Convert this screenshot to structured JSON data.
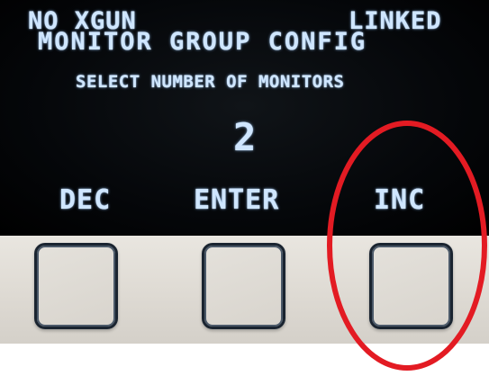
{
  "status": {
    "xgun": "NO XGUN",
    "link": "LINKED"
  },
  "screen": {
    "title": "MONITOR GROUP CONFIG",
    "prompt": "SELECT NUMBER OF MONITORS",
    "value": "2"
  },
  "softkeys": {
    "left": "DEC",
    "center": "ENTER",
    "right": "INC"
  },
  "colors": {
    "lcd_text": "#cfe6ff",
    "screen_background": "#000000",
    "panel": "#e3e0da",
    "button_border": "#1a2430",
    "annotation": "#e31b23"
  },
  "annotation": {
    "shape": "ellipse",
    "target": "INC"
  }
}
